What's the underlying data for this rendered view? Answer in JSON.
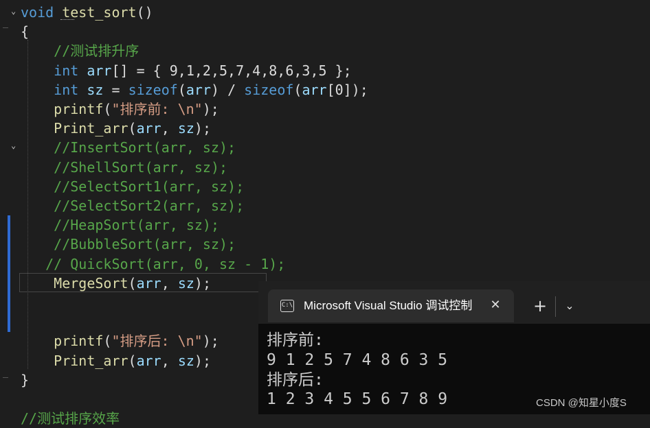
{
  "editor": {
    "lines": [
      [
        {
          "t": "void",
          "c": "kw"
        },
        {
          "t": " "
        },
        {
          "t": "test_sort",
          "c": "fn"
        },
        {
          "t": "()",
          "c": "op"
        }
      ],
      [
        {
          "t": "{",
          "c": "op"
        }
      ],
      [
        {
          "t": "    "
        },
        {
          "t": "//测试排升序",
          "c": "cm"
        }
      ],
      [
        {
          "t": "    "
        },
        {
          "t": "int",
          "c": "kw"
        },
        {
          "t": " "
        },
        {
          "t": "arr",
          "c": "var"
        },
        {
          "t": "[] = { 9,1,2,5,7,4,8,6,3,5 };",
          "c": "op"
        }
      ],
      [
        {
          "t": "    "
        },
        {
          "t": "int",
          "c": "kw"
        },
        {
          "t": " "
        },
        {
          "t": "sz",
          "c": "var"
        },
        {
          "t": " = ",
          "c": "op"
        },
        {
          "t": "sizeof",
          "c": "kw"
        },
        {
          "t": "(",
          "c": "op"
        },
        {
          "t": "arr",
          "c": "var"
        },
        {
          "t": ") / ",
          "c": "op"
        },
        {
          "t": "sizeof",
          "c": "kw"
        },
        {
          "t": "(",
          "c": "op"
        },
        {
          "t": "arr",
          "c": "var"
        },
        {
          "t": "[0]);",
          "c": "op"
        }
      ],
      [
        {
          "t": "    "
        },
        {
          "t": "printf",
          "c": "fn"
        },
        {
          "t": "(",
          "c": "op"
        },
        {
          "t": "\"排序前: \\n\"",
          "c": "str"
        },
        {
          "t": ");",
          "c": "op"
        }
      ],
      [
        {
          "t": "    "
        },
        {
          "t": "Print_arr",
          "c": "fn"
        },
        {
          "t": "(",
          "c": "op"
        },
        {
          "t": "arr",
          "c": "var"
        },
        {
          "t": ", ",
          "c": "op"
        },
        {
          "t": "sz",
          "c": "var"
        },
        {
          "t": ");",
          "c": "op"
        }
      ],
      [
        {
          "t": "    "
        },
        {
          "t": "//InsertSort(arr, sz);",
          "c": "cm"
        }
      ],
      [
        {
          "t": "    "
        },
        {
          "t": "//ShellSort(arr, sz);",
          "c": "cm"
        }
      ],
      [
        {
          "t": "    "
        },
        {
          "t": "//SelectSort1(arr, sz);",
          "c": "cm"
        }
      ],
      [
        {
          "t": "    "
        },
        {
          "t": "//SelectSort2(arr, sz);",
          "c": "cm"
        }
      ],
      [
        {
          "t": "    "
        },
        {
          "t": "//HeapSort(arr, sz);",
          "c": "cm"
        }
      ],
      [
        {
          "t": "    "
        },
        {
          "t": "//BubbleSort(arr, sz);",
          "c": "cm"
        }
      ],
      [
        {
          "t": "   "
        },
        {
          "t": "// QuickSort(arr, 0, sz - 1);",
          "c": "cm"
        }
      ],
      [
        {
          "t": "    "
        },
        {
          "t": "MergeSort",
          "c": "fn"
        },
        {
          "t": "(",
          "c": "op"
        },
        {
          "t": "arr",
          "c": "var"
        },
        {
          "t": ", ",
          "c": "op"
        },
        {
          "t": "sz",
          "c": "var"
        },
        {
          "t": ");",
          "c": "op"
        }
      ],
      [],
      [],
      [
        {
          "t": "    "
        },
        {
          "t": "printf",
          "c": "fn"
        },
        {
          "t": "(",
          "c": "op"
        },
        {
          "t": "\"排序后: \\n\"",
          "c": "str"
        },
        {
          "t": ");",
          "c": "op"
        }
      ],
      [
        {
          "t": "    "
        },
        {
          "t": "Print_arr",
          "c": "fn"
        },
        {
          "t": "(",
          "c": "op"
        },
        {
          "t": "arr",
          "c": "var"
        },
        {
          "t": ", ",
          "c": "op"
        },
        {
          "t": "sz",
          "c": "var"
        },
        {
          "t": ");",
          "c": "op"
        }
      ],
      [
        {
          "t": "}",
          "c": "op"
        }
      ],
      [],
      [
        {
          "t": "//测试排序效率",
          "c": "cm"
        }
      ]
    ],
    "fold_glyph": "⌄"
  },
  "console": {
    "tab_title": "Microsoft Visual Studio 调试控制台",
    "tab_icon_text": "C:\\",
    "close_glyph": "✕",
    "new_tab_glyph": "+",
    "dropdown_glyph": "⌄",
    "output": [
      "排序前:",
      "9 1 2 5 7 4 8 6 3 5",
      "排序后:",
      "1 2 3 4 5 5 6 7 8 9"
    ]
  },
  "watermark": "CSDN @知星小度S",
  "colors": {
    "background": "#1e1e1e",
    "keyword": "#569cd6",
    "function": "#dcdcaa",
    "variable": "#9cdcfe",
    "comment": "#57a64a",
    "string": "#d69d85",
    "console_bg": "#0c0c0c"
  }
}
